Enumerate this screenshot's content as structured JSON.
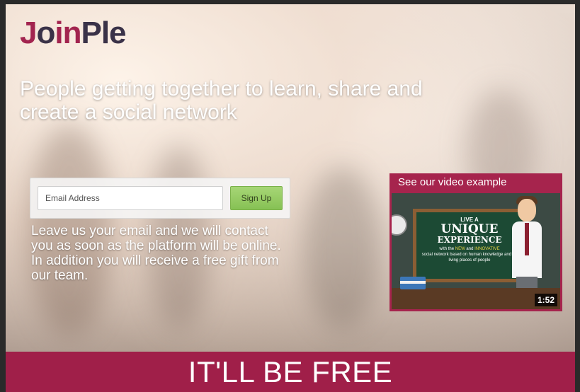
{
  "logo": {
    "j": "J",
    "o": "o",
    "in": "in",
    "ple": "Ple"
  },
  "headline": "People getting together to learn, share and create a social network",
  "signup": {
    "email_placeholder": "Email Address",
    "button_label": "Sign Up"
  },
  "info_text": "Leave us your email and we will contact you as soon as the platform will be online. In addition you will receive a free gift from our team.",
  "video": {
    "label": "See our video example",
    "board_line1": "LIVE A",
    "board_line2": "UNIQUE",
    "board_line3": "EXPERIENCE",
    "board_line4_pre": "with the ",
    "board_new": "NEW",
    "board_and": " and ",
    "board_innovative": "INNOVATIVE",
    "board_line5": "social network based on human knowledge and on living places of people",
    "duration": "1:52"
  },
  "banner": {
    "text": "IT'LL BE FREE"
  },
  "colors": {
    "brand": "#a01f49",
    "button": "#86c154",
    "logo_dark": "#3a3248"
  }
}
